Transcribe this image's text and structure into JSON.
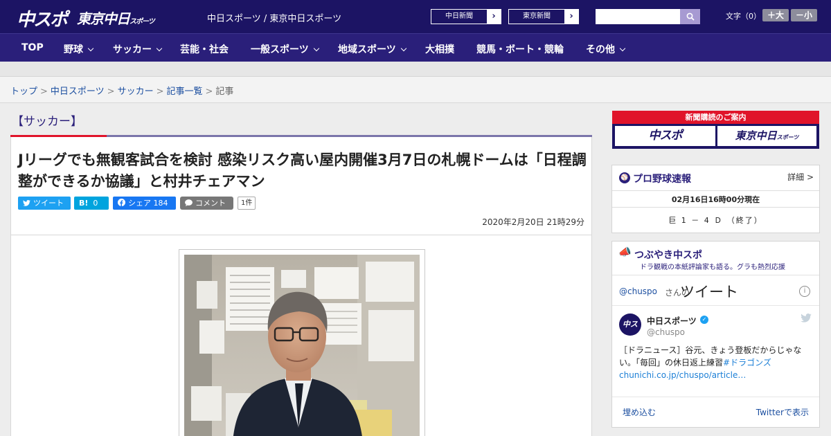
{
  "header": {
    "logo_chuspo": "中スポ",
    "logo_tokyo": "東京中日",
    "logo_tokyo_small": "スポーツ",
    "site_name": "中日スポーツ / 東京中日スポーツ",
    "ext_links": [
      {
        "label": "中日新聞",
        "arrow": "›"
      },
      {
        "label": "東京新聞",
        "arrow": "›"
      }
    ],
    "search": {
      "value": "",
      "placeholder": ""
    },
    "font_size_label": "文字（0）",
    "size_up": "＋大",
    "size_down": "－小"
  },
  "nav": [
    {
      "label": "TOP",
      "dropdown": false
    },
    {
      "label": "野球",
      "dropdown": true
    },
    {
      "label": "サッカー",
      "dropdown": true
    },
    {
      "label": "芸能・社会",
      "dropdown": false
    },
    {
      "label": "一般スポーツ",
      "dropdown": true
    },
    {
      "label": "地域スポーツ",
      "dropdown": true
    },
    {
      "label": "大相撲",
      "dropdown": false
    },
    {
      "label": "競馬・ボート・競輪",
      "dropdown": false
    },
    {
      "label": "その他",
      "dropdown": true
    }
  ],
  "breadcrumb": {
    "items": [
      "トップ",
      "中日スポーツ",
      "サッカー",
      "記事一覧"
    ],
    "current": "記事",
    "separator": ">"
  },
  "article": {
    "category": "【サッカー】",
    "headline": "Jリーグでも無観客試合を検討 感染リスク高い屋内開催3月7日の札幌ドームは「日程調整ができるか協議」と村井チェアマン",
    "share": {
      "tweet": "ツイート",
      "hatena_label": "B!",
      "hatena_count": "0",
      "facebook_label": "シェア",
      "facebook_count": "184",
      "comment_label": "コメント",
      "comment_count": "1件"
    },
    "date": "2020年2月20日 21時29分"
  },
  "sidebar": {
    "subscribe": {
      "title": "新聞購読のご案内",
      "paper1": "中スポ",
      "paper2": "東京中日",
      "paper2_small": "スポーツ"
    },
    "baseball": {
      "title": "プロ野球速報",
      "detail": "詳細 >",
      "time": "02月16日16時00分現在",
      "score": "巨 1 － 4 Ｄ （終了）"
    },
    "twitter": {
      "title": "つぶやき中スポ",
      "subtitle": "ドラ観戦の本紙評論家も語る。グラも熱烈応援",
      "handle": "@chuspo",
      "handle_suffix": "さんの",
      "heading": "ツイート",
      "tweet": {
        "name": "中日スポーツ",
        "user": "@chuspo",
        "text": "［ドラニュース］谷元、きょう登板だからじゃない。「毎回」の休日返上練習",
        "hashtag": "#ドラゴンズ",
        "link": "chunichi.co.jp/chuspo/article…"
      },
      "embed": "埋め込む",
      "view": "Twitterで表示"
    }
  },
  "colors": {
    "header_bg": "#1c1464",
    "nav_bg": "#2a1f7a",
    "accent_red": "#e0142a",
    "link": "#1c4fa0"
  }
}
